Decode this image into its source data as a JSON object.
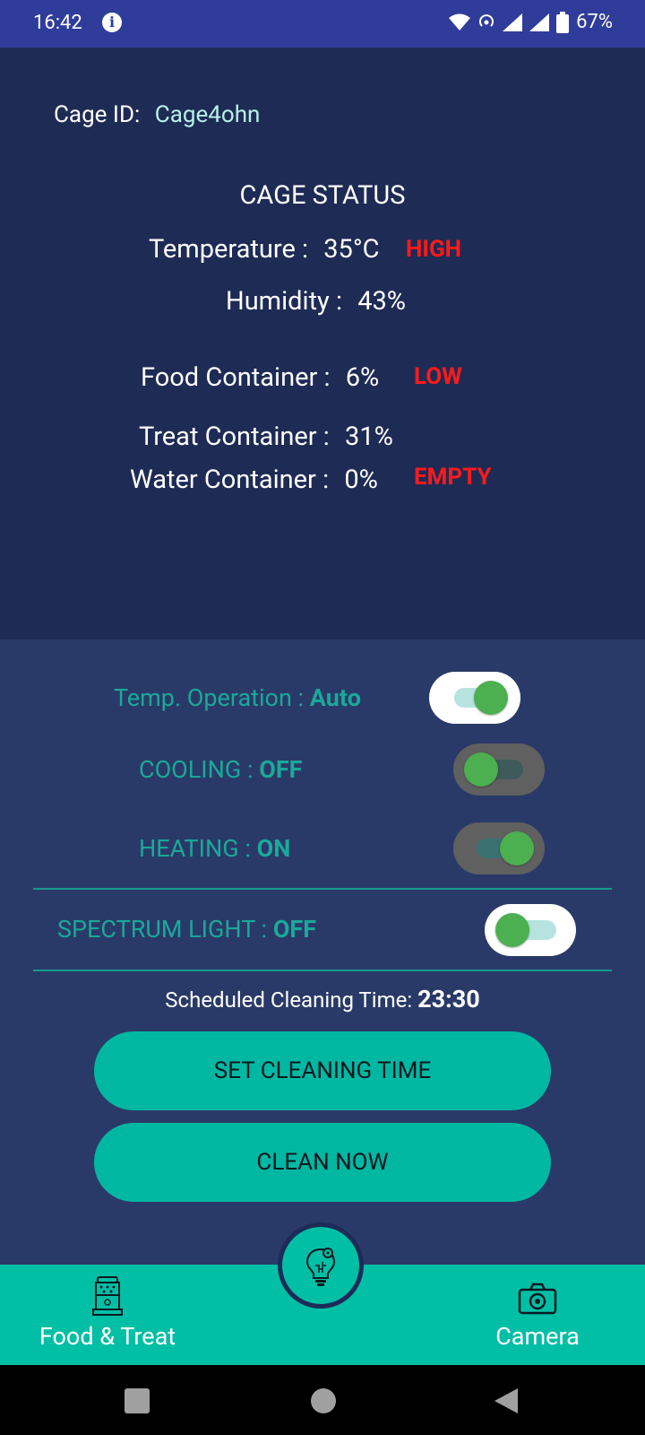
{
  "statusbar": {
    "time": "16:42",
    "battery": "67%"
  },
  "cage": {
    "id_label": "Cage ID:",
    "id_value": "Cage4ohn"
  },
  "status": {
    "title": "CAGE STATUS",
    "temperature_label": "Temperature :",
    "temperature_value": "35°C",
    "temperature_alert": "HIGH",
    "humidity_label": "Humidity :",
    "humidity_value": "43%",
    "food_label": "Food Container :",
    "food_value": "6%",
    "food_alert": "LOW",
    "treat_label": "Treat Container :",
    "treat_value": "31%",
    "water_label": "Water Container :",
    "water_value": "0%",
    "water_alert": "EMPTY"
  },
  "controls": {
    "temp_op_label": "Temp. Operation :",
    "temp_op_value": "Auto",
    "temp_op_on": true,
    "cooling_label": "COOLING :",
    "cooling_value": "OFF",
    "cooling_on": false,
    "heating_label": "HEATING :",
    "heating_value": "ON",
    "heating_on": true,
    "light_label": "SPECTRUM LIGHT :",
    "light_value": "OFF",
    "light_on": false
  },
  "cleaning": {
    "scheduled_label": "Scheduled Cleaning Time:",
    "scheduled_value": "23:30",
    "set_button": "SET CLEANING TIME",
    "clean_button": "CLEAN NOW"
  },
  "nav": {
    "food": "Food & Treat",
    "camera": "Camera"
  },
  "colors": {
    "accent": "#00bfa5",
    "alert": "#ff1a1a",
    "panel": "#1e2b55",
    "bg": "#2a3a68"
  }
}
